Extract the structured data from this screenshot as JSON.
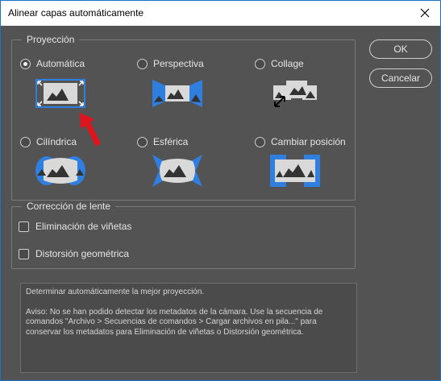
{
  "window": {
    "title": "Alinear capas automáticamente"
  },
  "buttons": {
    "ok_label": "OK",
    "cancel_label": "Cancelar"
  },
  "projection": {
    "legend": "Proyección",
    "options": [
      {
        "label": "Automática",
        "selected": true,
        "icon": "auto-layout-icon"
      },
      {
        "label": "Perspectiva",
        "selected": false,
        "icon": "perspective-icon"
      },
      {
        "label": "Collage",
        "selected": false,
        "icon": "collage-icon"
      },
      {
        "label": "Cilíndrica",
        "selected": false,
        "icon": "cylindrical-icon"
      },
      {
        "label": "Esférica",
        "selected": false,
        "icon": "spherical-icon"
      },
      {
        "label": "Cambiar posición",
        "selected": false,
        "icon": "reposition-icon"
      }
    ]
  },
  "lens": {
    "legend": "Corrección de lente",
    "options": [
      {
        "label": "Eliminación de viñetas",
        "checked": false
      },
      {
        "label": "Distorsión geométrica",
        "checked": false
      }
    ]
  },
  "description": {
    "line1": "Determinar automáticamente la mejor proyección.",
    "line2": "Aviso: No se han podido detectar los metadatos de la cámara. Use la secuencia de comandos \"Archivo > Secuencias de comandos > Cargar archivos en pila...\" para conservar los metadatos para Eliminación de viñetas o Distorsión geométrica."
  },
  "colors": {
    "accent_blue": "#2f7fe0",
    "arrow_red": "#e0141c",
    "dialog_bg": "#535353",
    "image_gray": "#d9d9d9"
  }
}
